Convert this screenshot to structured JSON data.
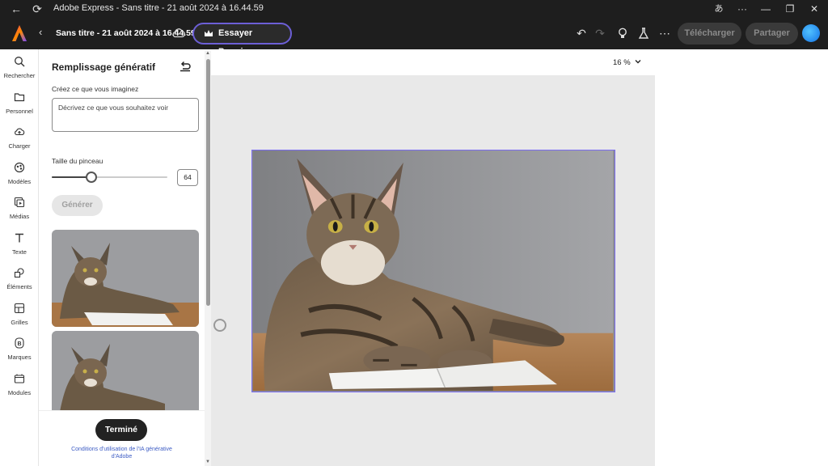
{
  "titlebar": {
    "title": "Adobe Express - Sans titre - 21 août 2024 à 16.44.59",
    "lang_icon": "あ"
  },
  "header": {
    "doc_title": "Sans titre - 21 août 2024 à 16.44.59",
    "premium_label": "Essayer Premium",
    "download_label": "Télécharger",
    "share_label": "Partager"
  },
  "rail": {
    "items": [
      {
        "label": "Rechercher",
        "icon": "search-icon"
      },
      {
        "label": "Personnel",
        "icon": "folder-icon"
      },
      {
        "label": "Charger",
        "icon": "upload-icon"
      },
      {
        "label": "Modèles",
        "icon": "templates-icon"
      },
      {
        "label": "Médias",
        "icon": "media-icon"
      },
      {
        "label": "Texte",
        "icon": "text-icon"
      },
      {
        "label": "Éléments",
        "icon": "elements-icon"
      },
      {
        "label": "Grilles",
        "icon": "grids-icon"
      },
      {
        "label": "Marques",
        "icon": "brands-icon"
      },
      {
        "label": "Modules",
        "icon": "modules-icon"
      }
    ]
  },
  "panel": {
    "title": "Remplissage génératif",
    "prompt_label": "Créez ce que vous imaginez",
    "prompt_placeholder": "Décrivez ce que vous souhaitez voir",
    "brush_label": "Taille du pinceau",
    "brush_value": "64",
    "brush_fraction": 0.34,
    "generate_label": "Générer",
    "done_label": "Terminé",
    "terms_link": "Conditions d'utilisation de l'IA générative d'Adobe"
  },
  "canvas": {
    "zoom": "16 %",
    "selection_color": "#7a6cf0"
  },
  "colors": {
    "premium_border": "#6c5fd6",
    "accent": "#1473e6"
  }
}
